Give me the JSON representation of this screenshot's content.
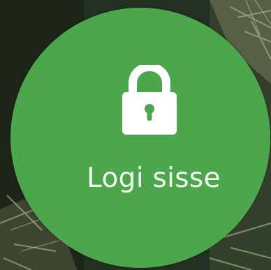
{
  "login_tile": {
    "icon": "lock-icon",
    "label": "Logi sisse",
    "background_color": "#4ca64c",
    "text_color": "#f4f8f2"
  }
}
